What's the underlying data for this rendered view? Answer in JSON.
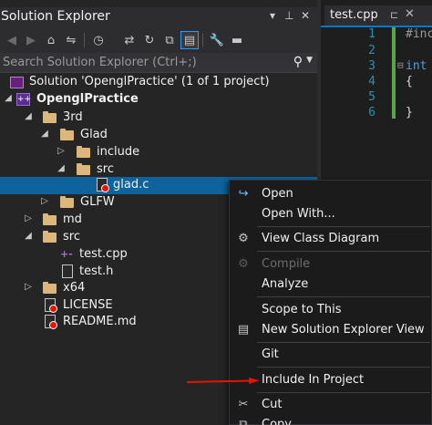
{
  "solution_explorer": {
    "title": "Solution Explorer",
    "title_buttons": [
      "▾",
      "⊥",
      "✕"
    ],
    "search_placeholder": "Search Solution Explorer (Ctrl+;)",
    "solution_label": "Solution 'OpenglPractice' (1 of 1 project)",
    "project_label": "OpenglPractice",
    "tree": [
      {
        "label": "3rd"
      },
      {
        "label": "Glad"
      },
      {
        "label": "include"
      },
      {
        "label": "src"
      },
      {
        "label": "glad.c"
      },
      {
        "label": "GLFW"
      },
      {
        "label": "md"
      },
      {
        "label": "src"
      },
      {
        "label": "test.cpp"
      },
      {
        "label": "test.h"
      },
      {
        "label": "x64"
      },
      {
        "label": "LICENSE"
      },
      {
        "label": "README.md"
      }
    ]
  },
  "editor": {
    "tab_name": "test.cpp",
    "line_numbers": [
      "1",
      "2",
      "3",
      "4",
      "5",
      "6"
    ],
    "code_lines": [
      "#inc",
      "",
      "int",
      "{",
      "",
      "}"
    ]
  },
  "context_menu": {
    "items": [
      {
        "label": "Open"
      },
      {
        "label": "Open With..."
      },
      {
        "label": "View Class Diagram"
      },
      {
        "label": "Compile"
      },
      {
        "label": "Analyze"
      },
      {
        "label": "Scope to This"
      },
      {
        "label": "New Solution Explorer View"
      },
      {
        "label": "Git"
      },
      {
        "label": "Include In Project"
      },
      {
        "label": "Cut"
      },
      {
        "label": "Copy"
      }
    ]
  },
  "colors": {
    "selection": "#0e639c",
    "accent": "#007acc",
    "arrow": "#e51400",
    "folder": "#dcb67a"
  }
}
